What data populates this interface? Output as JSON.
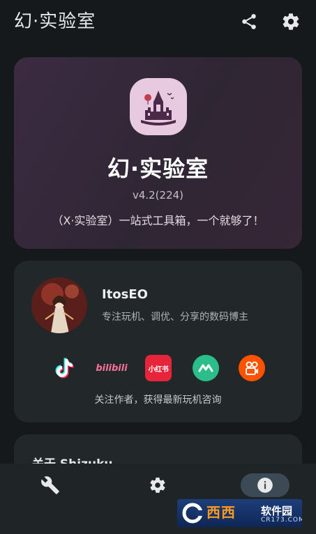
{
  "app_bar": {
    "title": "幻·实验室",
    "share_icon": "share-icon",
    "settings_icon": "gear-icon"
  },
  "hero": {
    "title": "幻·实验室",
    "version": "v4.2(224)",
    "slogan": "（X·实验室）一站式工具箱，一个就够了！",
    "logo_icon": "castle-logo-icon",
    "logo_color": "#e7c9e0"
  },
  "author": {
    "name": "ItosEO",
    "description": "专注玩机、调优、分享的数码博主",
    "follow_text": "关注作者，获得最新玩机咨询",
    "socials": [
      {
        "name": "douyin-icon"
      },
      {
        "name": "bilibili-icon",
        "text": "bilibili"
      },
      {
        "name": "xiaohongshu-icon",
        "text": "小红书"
      },
      {
        "name": "kuaishou-icon"
      },
      {
        "name": "kuaishou-app-icon"
      }
    ]
  },
  "shizuku": {
    "title": "关于 Shizuku"
  },
  "bottom_nav": {
    "items": [
      {
        "name": "tools",
        "icon": "wrench-icon"
      },
      {
        "name": "settings",
        "icon": "gear-icon"
      },
      {
        "name": "about",
        "icon": "info-icon",
        "selected": true
      }
    ]
  },
  "watermark": {
    "brand": "西西",
    "text": "软件园",
    "url": "CR173.COM"
  },
  "colors": {
    "background": "#16191c",
    "card": "#22272a",
    "hero_gradient_start": "#3c2b42",
    "nav_selected": "#3c4a55"
  }
}
